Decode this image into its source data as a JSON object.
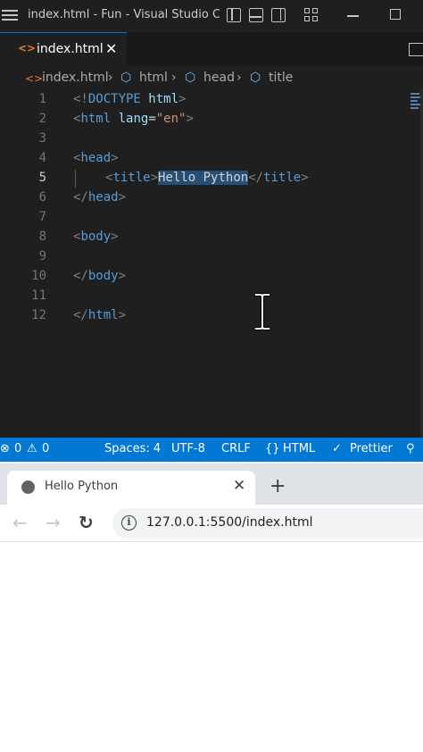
{
  "vscode": {
    "window_title": "index.html - Fun - Visual Studio C...",
    "tab": {
      "file_icon": "<>",
      "label": "index.html",
      "close": "✕"
    },
    "breadcrumb": {
      "file": "index.html",
      "sep": "›",
      "items": [
        "html",
        "head",
        "title"
      ]
    },
    "editor": {
      "line_numbers": [
        "1",
        "2",
        "3",
        "4",
        "5",
        "6",
        "7",
        "8",
        "9",
        "10",
        "11",
        "12"
      ],
      "active_line": "5",
      "lines": {
        "l1": {
          "open": "<!",
          "doctype": "DOCTYPE",
          "html": " html",
          "close": ">"
        },
        "l2": {
          "open": "<",
          "tag": "html",
          "attr": " lang",
          "eq": "=",
          "val": "\"en\"",
          "close": ">"
        },
        "l4": {
          "open": "<",
          "tag": "head",
          "close": ">"
        },
        "l5": {
          "open": "<",
          "tag": "title",
          "close": ">",
          "text": "Hello Python",
          "end_open": "</",
          "end_tag": "title",
          "end_close": ">"
        },
        "l6": {
          "open": "</",
          "tag": "head",
          "close": ">"
        },
        "l8": {
          "open": "<",
          "tag": "body",
          "close": ">"
        },
        "l10": {
          "open": "</",
          "tag": "body",
          "close": ">"
        },
        "l12": {
          "open": "</",
          "tag": "html",
          "close": ">"
        }
      }
    },
    "status": {
      "errors": "0",
      "warnings": "0",
      "spaces": "Spaces: 4",
      "encoding": "UTF-8",
      "eol": "CRLF",
      "language": "HTML",
      "formatter": "Prettier"
    }
  },
  "browser": {
    "tab_title": "Hello Python",
    "tab_close": "✕",
    "new_tab": "+",
    "url": "127.0.0.1:5500/index.html",
    "info_icon": "i"
  },
  "colors": {
    "editor_bg": "#1f1f1f",
    "status_bar": "#0078d4",
    "tag": "#569cd6",
    "selection": "#264f78"
  }
}
